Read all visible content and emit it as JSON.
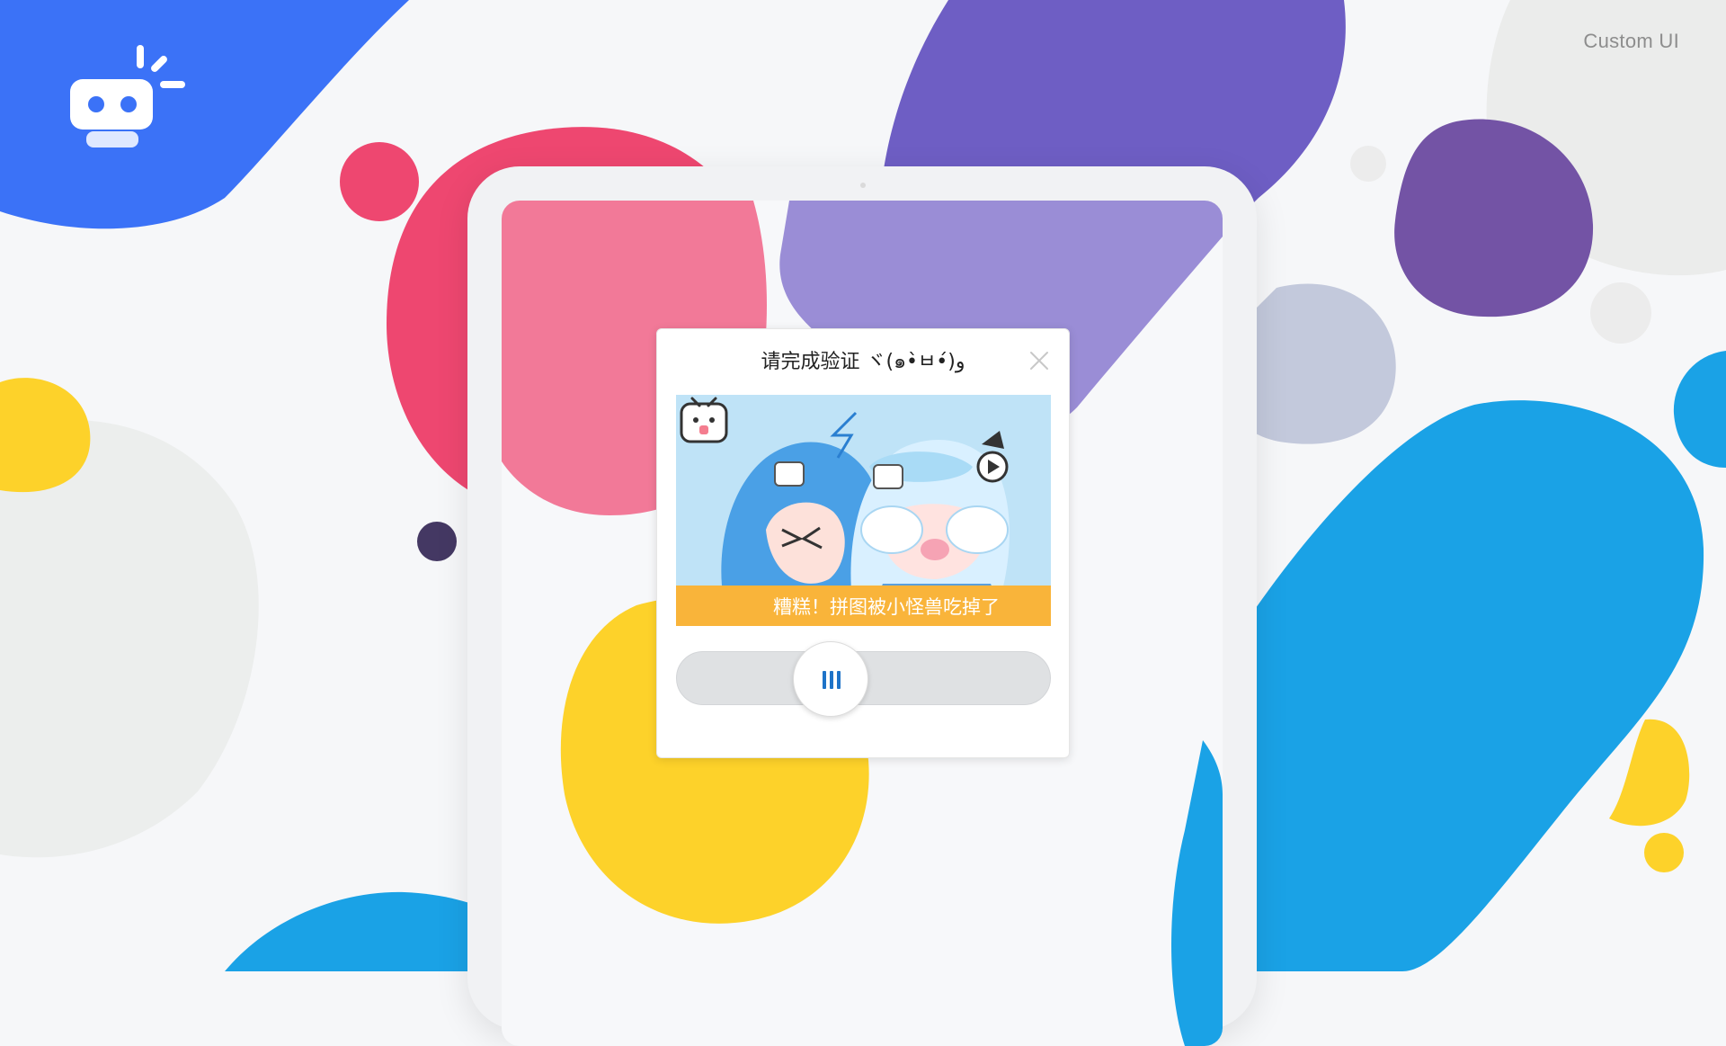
{
  "header": {
    "brand_label": "Custom UI"
  },
  "captcha": {
    "title": "请完成验证 ヾ(๑•̀ㅂ•́)و",
    "error_message": "糟糕！拼图被小怪兽吃掉了",
    "close_icon": "close-icon",
    "slider_grip_icon": "grip-bars-icon",
    "slider_position": 0.39
  },
  "colors": {
    "brand_blue": "#3b72f7",
    "accent_blue": "#1aa2e6",
    "purple": "#6e5ec4",
    "pink": "#ee4770",
    "yellow": "#fdd22a",
    "banner_orange": "#f9b43a",
    "grip_blue": "#1e73c8"
  }
}
